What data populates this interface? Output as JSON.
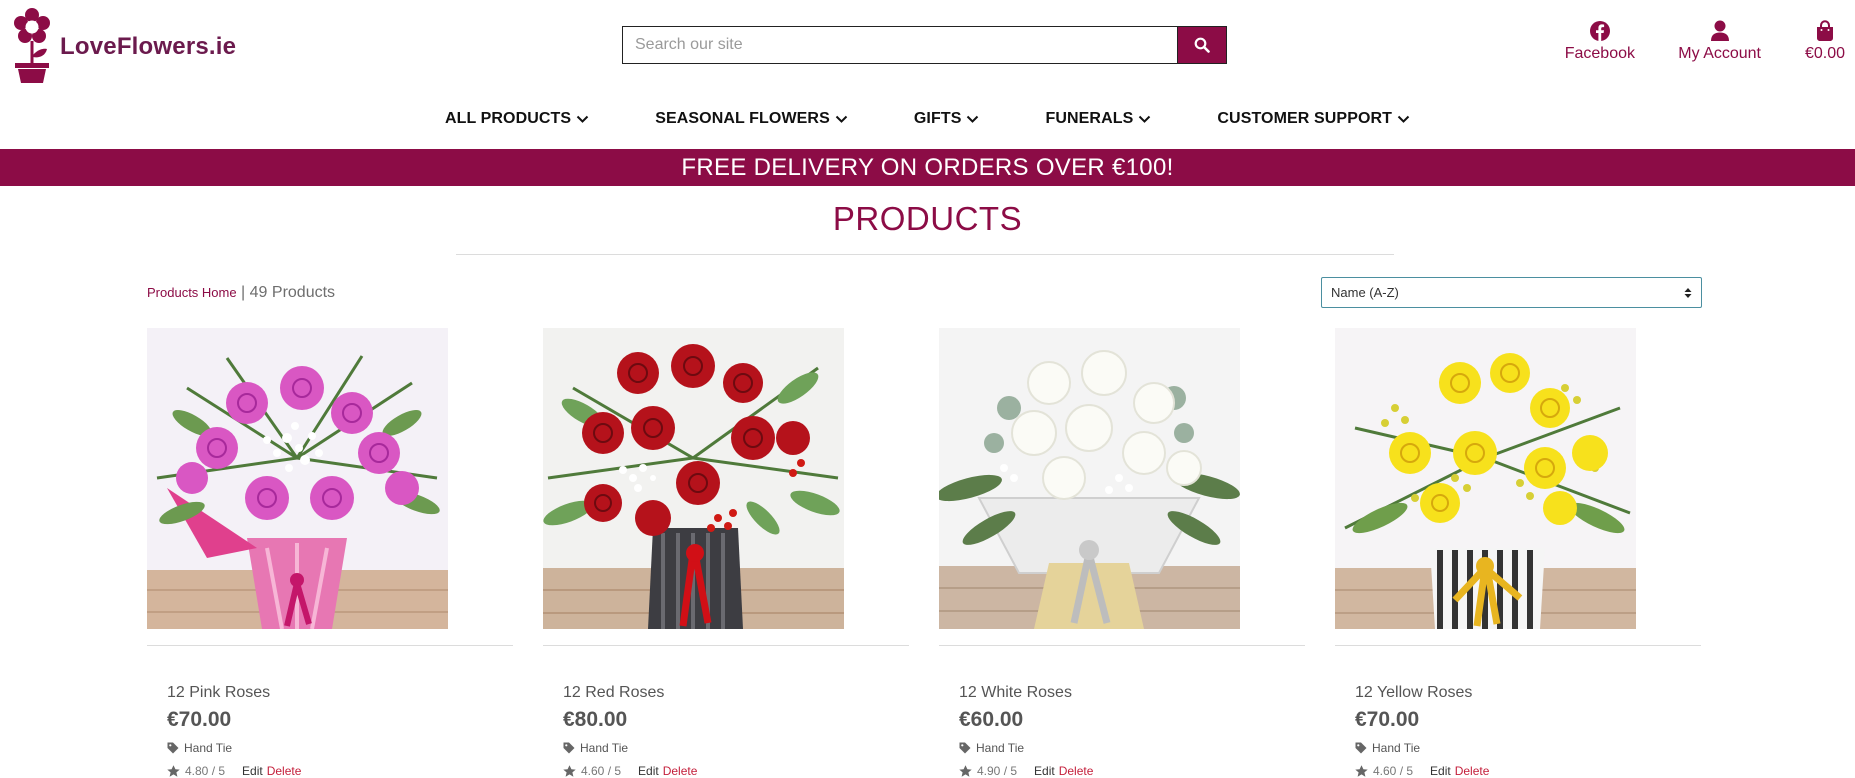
{
  "brand": {
    "name": "LoveFlowers.ie",
    "color": "#8c0c46",
    "logo_icon": "flower-pot-icon"
  },
  "search": {
    "placeholder": "Search our site",
    "icon": "search-icon"
  },
  "header_links": {
    "facebook": "Facebook",
    "account": "My Account",
    "bag_total": "€0.00"
  },
  "nav": {
    "items": [
      {
        "label": "ALL PRODUCTS"
      },
      {
        "label": "SEASONAL FLOWERS"
      },
      {
        "label": "GIFTS"
      },
      {
        "label": "FUNERALS"
      },
      {
        "label": "CUSTOMER SUPPORT"
      }
    ]
  },
  "banner": {
    "text": "FREE DELIVERY ON ORDERS OVER €100!"
  },
  "page": {
    "title": "PRODUCTS"
  },
  "toolbar": {
    "crumb_link": "Products Home",
    "separator": "|",
    "count": "49 Products",
    "sort_value": "Name (A-Z)"
  },
  "products": [
    {
      "name": "12 Pink Roses",
      "price": "€70.00",
      "category": "Hand Tie",
      "rating": "4.80 / 5",
      "edit": "Edit",
      "delete": "Delete"
    },
    {
      "name": "12 Red Roses",
      "price": "€80.00",
      "category": "Hand Tie",
      "rating": "4.60 / 5",
      "edit": "Edit",
      "delete": "Delete"
    },
    {
      "name": "12 White Roses",
      "price": "€60.00",
      "category": "Hand Tie",
      "rating": "4.90 / 5",
      "edit": "Edit",
      "delete": "Delete"
    },
    {
      "name": "12 Yellow Roses",
      "price": "€70.00",
      "category": "Hand Tie",
      "rating": "4.60 / 5",
      "edit": "Edit",
      "delete": "Delete"
    }
  ]
}
